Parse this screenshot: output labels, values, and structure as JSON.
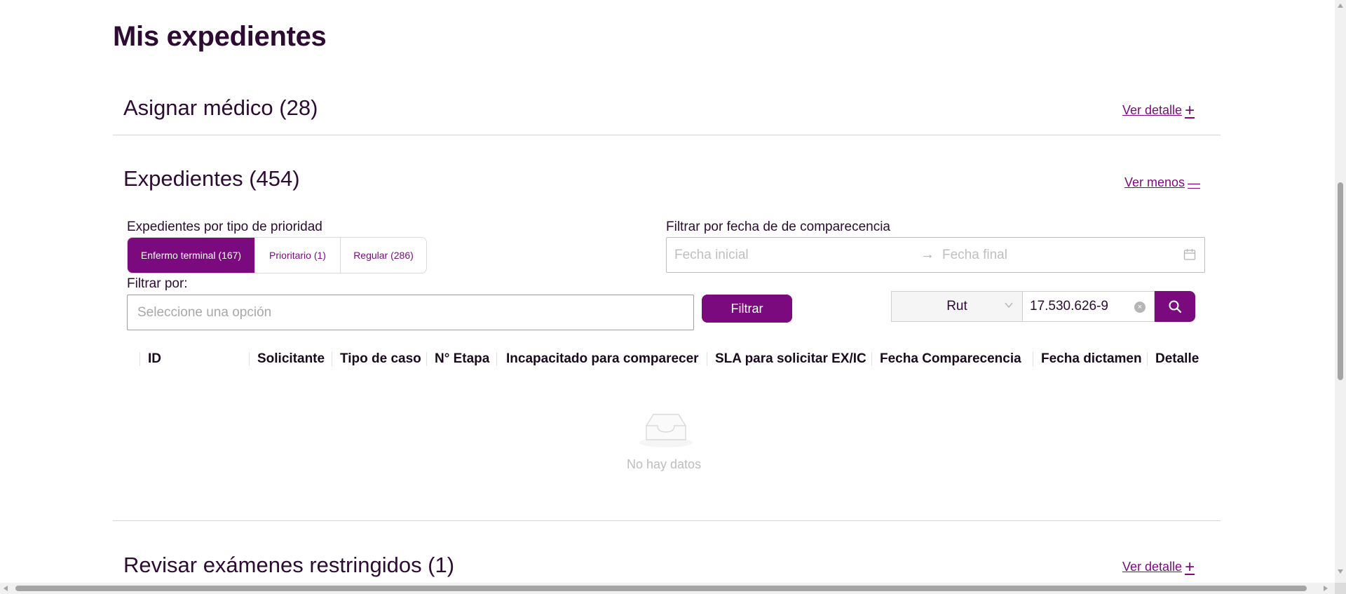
{
  "page": {
    "title": "Mis expedientes"
  },
  "sections": {
    "assign": {
      "title": "Asignar médico (28)",
      "toggle_label": "Ver detalle",
      "toggle_symbol": "+"
    },
    "expedientes": {
      "title": "Expedientes (454)",
      "toggle_label": "Ver menos",
      "toggle_symbol": "—"
    },
    "restricted": {
      "title": "Revisar exámenes restringidos (1)",
      "toggle_label": "Ver detalle",
      "toggle_symbol": "+"
    }
  },
  "priority": {
    "label": "Expedientes por tipo de prioridad",
    "options": [
      {
        "label": "Enfermo terminal (167)",
        "active": true
      },
      {
        "label": "Prioritario (1)",
        "active": false
      },
      {
        "label": "Regular (286)",
        "active": false
      }
    ]
  },
  "date_filter": {
    "label": "Filtrar por fecha de de comparecencia",
    "start_placeholder": "Fecha inicial",
    "end_placeholder": "Fecha final",
    "separator": "→"
  },
  "filter": {
    "label": "Filtrar por:",
    "placeholder": "Seleccione una opción",
    "button_label": "Filtrar"
  },
  "search": {
    "field_type": "Rut",
    "value": "17.530.626-9",
    "clear_symbol": "×"
  },
  "table": {
    "columns": [
      "ID",
      "Solicitante",
      "Tipo de caso",
      "N° Etapa",
      "Incapacitado para comparecer",
      "SLA para solicitar EX/IC",
      "Fecha Comparecencia",
      "Fecha dictamen",
      "Detalle"
    ],
    "empty_text": "No hay datos"
  },
  "colors": {
    "accent": "#7a0a7e",
    "heading": "#2d0b33",
    "divider": "#d6d2d8"
  },
  "icons": [
    "plus-icon",
    "minus-icon",
    "calendar-icon",
    "chevron-down-icon",
    "clear-icon",
    "search-icon",
    "empty-inbox-icon"
  ]
}
